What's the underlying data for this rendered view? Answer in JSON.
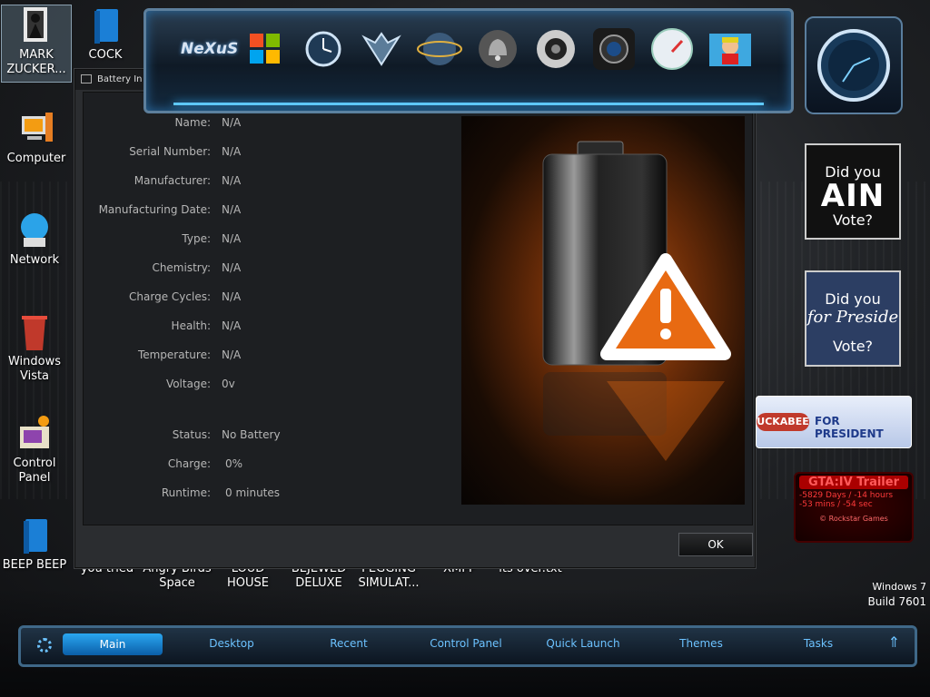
{
  "desktop_icons": [
    {
      "label": "MARK ZUCKER..."
    },
    {
      "label": "COCK"
    },
    {
      "label": "Computer"
    },
    {
      "label": "Network"
    },
    {
      "label": "Windows Vista"
    },
    {
      "label": "Control Panel"
    },
    {
      "label": "BEEP BEEP"
    },
    {
      "label": "you tried"
    },
    {
      "label": "Angry Birds Space"
    },
    {
      "label": "LOUD HOUSE"
    },
    {
      "label": "BEJEWED DELUXE"
    },
    {
      "label": "PEGGING SIMULAT..."
    },
    {
      "label": "XMPP"
    },
    {
      "label": "its over.txt"
    }
  ],
  "dock": {
    "logo": "NeXuS"
  },
  "dialog": {
    "title": "Battery In",
    "fields": [
      {
        "label": "Name:",
        "value": "N/A"
      },
      {
        "label": "Serial Number:",
        "value": "N/A"
      },
      {
        "label": "Manufacturer:",
        "value": "N/A"
      },
      {
        "label": "Manufacturing Date:",
        "value": "N/A"
      },
      {
        "label": "Type:",
        "value": "N/A"
      },
      {
        "label": "Chemistry:",
        "value": "N/A"
      },
      {
        "label": "Charge Cycles:",
        "value": "N/A"
      },
      {
        "label": "Health:",
        "value": "N/A"
      },
      {
        "label": "Temperature:",
        "value": "N/A"
      },
      {
        "label": "Voltage:",
        "value": "0v"
      }
    ],
    "status": [
      {
        "label": "Status:",
        "value": "No Battery"
      },
      {
        "label": "Charge:",
        "value": "0%"
      },
      {
        "label": "Runtime:",
        "value": "0 minutes"
      }
    ],
    "ok_label": "OK"
  },
  "widgets": {
    "vote1": {
      "line1": "Did you",
      "line2": "AIN",
      "line3": "Vote?"
    },
    "vote2": {
      "line1": "Did you",
      "line2": "for Preside",
      "line3": "Vote?"
    },
    "huckabee": {
      "left": "UCKABEE",
      "right": "FOR PRESIDENT"
    },
    "gta": {
      "title": "GTA:IV Trailer",
      "line1": "-5829 Days / -14 hours",
      "line2": "-53 mins / -54 sec",
      "footer": "© Rockstar Games"
    }
  },
  "build": {
    "line1": "Windows 7",
    "line2": "Build 7601"
  },
  "taskbar": {
    "items": [
      "Main",
      "Desktop",
      "Recent",
      "Control Panel",
      "Quick Launch",
      "Themes",
      "Tasks"
    ]
  }
}
